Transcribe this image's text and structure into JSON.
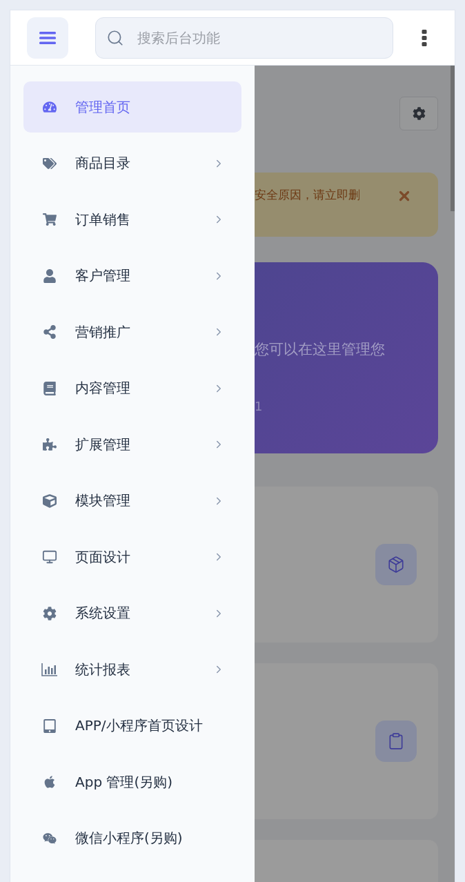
{
  "header": {
    "search": {
      "placeholder": "搜索后台功能"
    }
  },
  "sidebar": {
    "items": [
      {
        "label": "管理首页",
        "selected": true,
        "expandable": false
      },
      {
        "label": "商品目录",
        "selected": false,
        "expandable": true
      },
      {
        "label": "订单销售",
        "selected": false,
        "expandable": true
      },
      {
        "label": "客户管理",
        "selected": false,
        "expandable": true
      },
      {
        "label": "营销推广",
        "selected": false,
        "expandable": true
      },
      {
        "label": "内容管理",
        "selected": false,
        "expandable": true
      },
      {
        "label": "扩展管理",
        "selected": false,
        "expandable": true
      },
      {
        "label": "模块管理",
        "selected": false,
        "expandable": true
      },
      {
        "label": "页面设计",
        "selected": false,
        "expandable": true
      },
      {
        "label": "系统设置",
        "selected": false,
        "expandable": true
      },
      {
        "label": "统计报表",
        "selected": false,
        "expandable": true
      },
      {
        "label": "APP/小程序首页设计",
        "selected": false,
        "expandable": false
      },
      {
        "label": "App 管理(另购)",
        "selected": false,
        "expandable": false
      },
      {
        "label": "微信小程序(另购)",
        "selected": false,
        "expandable": false
      }
    ]
  },
  "content": {
    "alert": {
      "text": "安全原因，请立即删"
    },
    "banner": {
      "text": "您可以在这里管理您",
      "subtext": "1"
    },
    "cards": [
      {
        "kind": "box"
      },
      {
        "kind": "clipboard"
      },
      {
        "kind": "empty"
      }
    ]
  }
}
